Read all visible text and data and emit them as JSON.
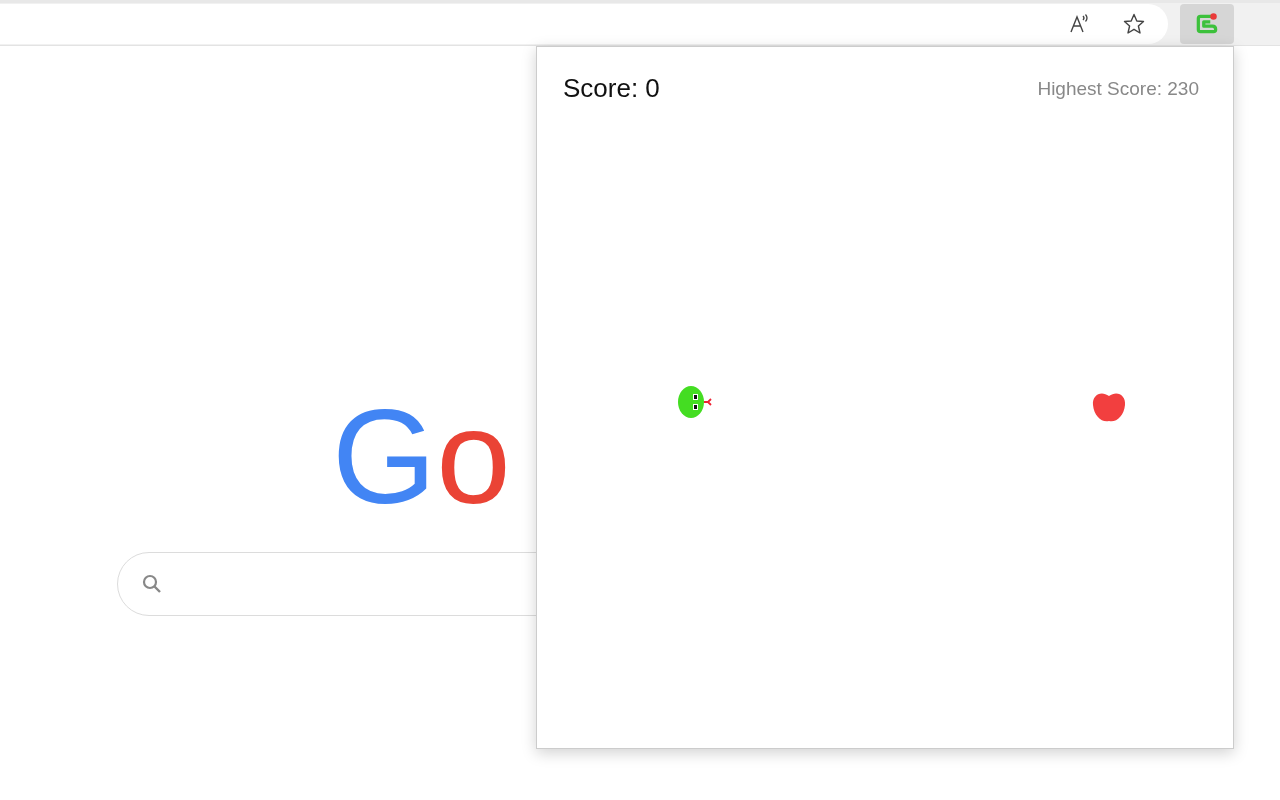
{
  "logo": {
    "letters": [
      {
        "text": "G",
        "color": "#4285f4"
      },
      {
        "text": "o",
        "color": "#ea4335"
      }
    ]
  },
  "popup": {
    "score": "Score: 0",
    "highest_score": "Highest Score: 230"
  }
}
